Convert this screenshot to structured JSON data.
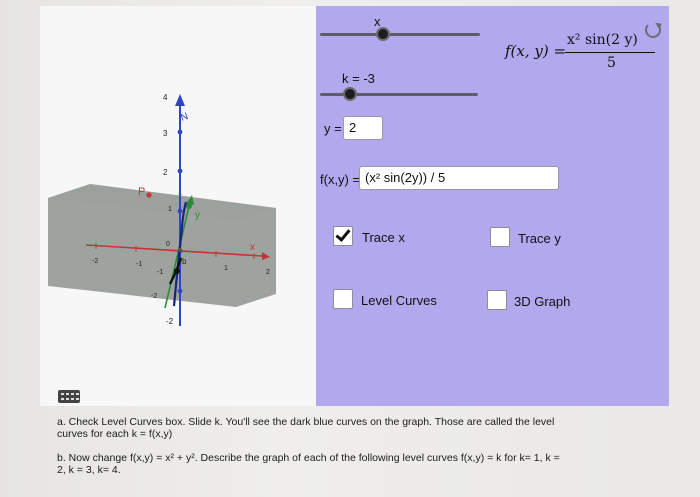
{
  "graphics": {
    "axis_labels": {
      "z": "N",
      "y": "y",
      "x": "x"
    },
    "point_p_label": "P",
    "z_ticks": [
      "4",
      "3",
      "2",
      "1",
      "-2"
    ],
    "y_ticks": [
      "2",
      "-1",
      "-2"
    ],
    "x_ticks": [
      "-2",
      "-1",
      "1",
      "2"
    ],
    "small_labels": {
      "origin": "0",
      "b": "b"
    }
  },
  "controls": {
    "slider_x_label": "x",
    "slider_k_label": "k = -3",
    "y_label": "y =",
    "y_value": "2",
    "f_label": "f(x,y) =",
    "f_value": "(x² sin(2y)) / 5",
    "checkboxes": [
      {
        "label": "Trace x",
        "checked": true
      },
      {
        "label": "Trace y",
        "checked": false
      },
      {
        "label": "Level Curves",
        "checked": false
      },
      {
        "label": "3D Graph",
        "checked": false
      }
    ]
  },
  "formula": {
    "lhs": "f(x, y) =",
    "numerator": "x² sin(2 y)",
    "denominator": "5"
  },
  "instructions": {
    "part_a_line1": "a. Check Level Curves box.  Slide k.  You'll see the dark blue curves on the graph.  Those are called the level",
    "part_a_line2": "curves for each k = f(x,y)",
    "part_b_line1": "b. Now change f(x,y) = x² + y². Describe the graph of each of the following level curves f(x,y) = k for k= 1, k =",
    "part_b_line2": "2, k = 3, k= 4."
  },
  "colors": {
    "panel": "#b1a8ee",
    "plane": "#8f948f",
    "axis_red": "#c33636",
    "axis_green": "#2b8a3e",
    "axis_blue": "#2f45c8"
  }
}
